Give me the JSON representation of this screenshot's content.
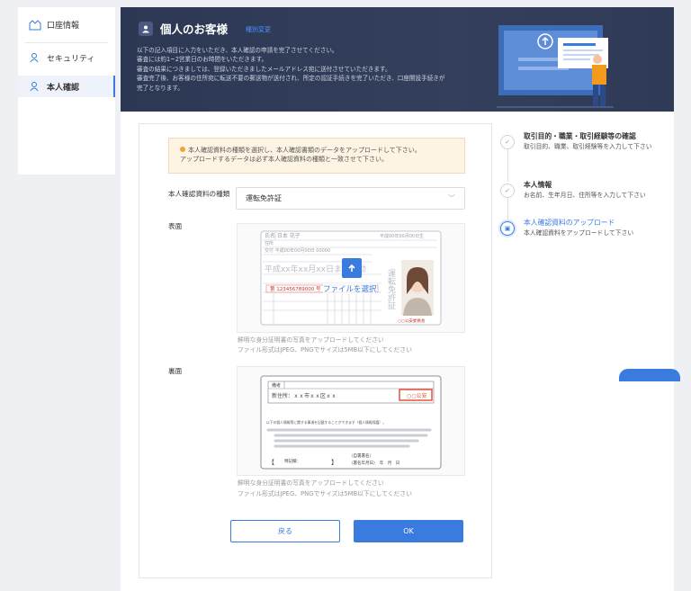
{
  "sidebar": {
    "items": [
      {
        "label": "口座情報",
        "icon": "account-icon"
      },
      {
        "label": "セキュリティ",
        "icon": "user-shield-icon"
      },
      {
        "label": "本人確認",
        "icon": "user-check-icon"
      }
    ]
  },
  "header": {
    "title": "個人のお客様",
    "change_link": "種別変更",
    "description": [
      "以下の記入項目に入力をいただき、本人確認の申請を完了させてください。",
      "審査には約1~2営業日のお時間をいただきます。",
      "審査の結果につきましては、登録いただきましたメールアドレス宛に送付させていただきます。",
      "審査完了後、お客様の住所宛に転送不要の郵送物が送付され、所定の認証手続きを完了いただき、口座開設手続きが",
      "完了となります。"
    ]
  },
  "notice": {
    "line1": "本人確認資料の種類を選択し、本人確認書類のデータをアップロードして下さい。",
    "line2": "アップロードするデータは必ず本人確認資料の種類と一致させて下さい。"
  },
  "form": {
    "doc_type_label": "本人確認資料の種類",
    "doc_type_value": "運転免許証",
    "front_label": "表面",
    "back_label": "裏面",
    "upload_label": "ファイルを選択",
    "note1": "鮮明な身分証明書の写真をアップロードしてください",
    "note2": "ファイル形式はJPEG、PNGでサイズは5MB以下にしてください"
  },
  "license_front": {
    "name_row": "氏名 日本 花子",
    "birth": "平成00年00月00日生",
    "address": "住所",
    "issue": "交付 平成00年00月00日 00000",
    "expiry": "平成xx年xx月xx日まで有効",
    "license_vertical": "運転免許証",
    "number": "第 123456789000 号",
    "public_safety": "○○公安委員会"
  },
  "license_back": {
    "header": "備考",
    "new_address": "新住所：ｘｘ市ｘｘ区ｘｘ",
    "stamp": "○○公安",
    "notes_text": "以下の個人情報等に関する事項を記載することができます（個人情報保護）。",
    "donor_label": "特記欄：",
    "signature_label": "（自署署名）",
    "date_label": "（署名年月日）　年　月　日"
  },
  "buttons": {
    "back": "戻る",
    "ok": "OK"
  },
  "steps": [
    {
      "title": "取引目的・職業・取引経験等の確認",
      "desc": "取引目的、職業、取引経験等を入力して下さい",
      "state": "done"
    },
    {
      "title": "本人情報",
      "desc": "お名前、生年月日、住所等を入力して下さい",
      "state": "done"
    },
    {
      "title": "本人確認資料のアップロード",
      "desc": "本人確認資料をアップロードして下さい",
      "state": "active"
    }
  ],
  "colors": {
    "accent": "#3a7be0",
    "header_bg": "#2c3853",
    "notice_bg": "#fdf4e4"
  }
}
